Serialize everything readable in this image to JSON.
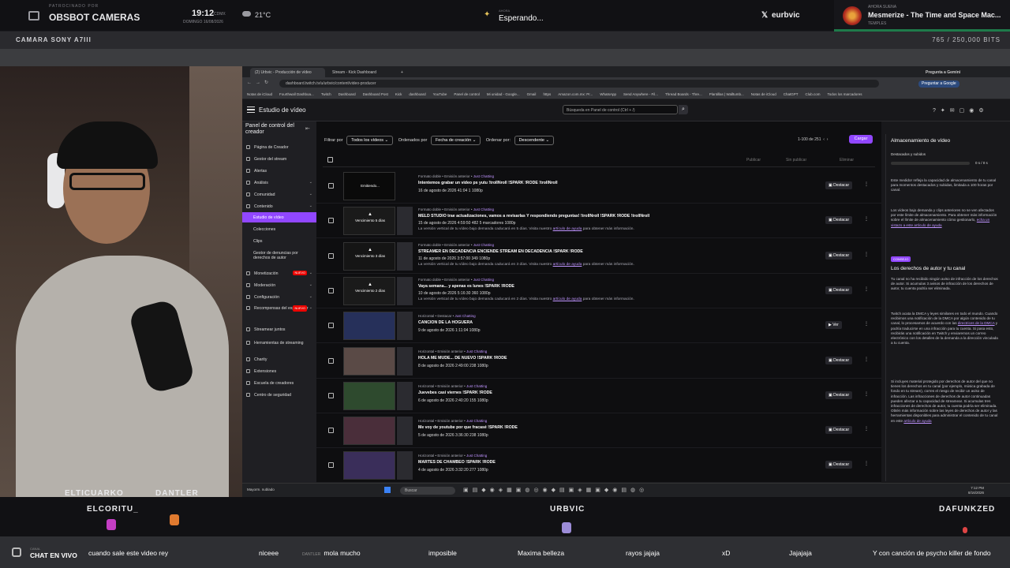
{
  "overlay": {
    "camera_sub": "PATROCINADO POR",
    "camera_name": "OBSBOT CAMERAS",
    "time": "19:12",
    "timezone": "CDMX",
    "date": "DOMINGO 16/08/2026",
    "temperature": "21°C",
    "now_playing_sub": "AHORA",
    "now_playing": "Esperando...",
    "x_handle": "eurbvic",
    "song_sub": "AHORA SUENA",
    "song_title": "Mesmerize - The Time and Space Mac...",
    "song_artist": "TEMPLES",
    "camera_label": "CAMARA SONY A7III",
    "bits": "765 / 250,000 BITS"
  },
  "browser": {
    "tabs": [
      "(2) Urbvic - Producción de vídeo",
      "Stream - Kick Dashboard",
      "+"
    ],
    "address": "dashboard.twitch.tv/u/urbvic/content/video-producer",
    "gemini": "Pregunta a Gemini",
    "google_btn": "Preguntar a Google",
    "bookmarks": [
      "Notas de iCloud",
      "Fourthwall Dashboa...",
      "Twitch",
      "Dashboard",
      "Dashboard Post",
      "Kick",
      "dashboard",
      "YouTube",
      "Panel de control",
      "Mi unidad - Google...",
      "Gmail",
      "https",
      "Amazon.com.mx: Pr...",
      "WhatsApp",
      "Send Anywhere - Fil...",
      "Thread Boards - Thre...",
      "Plantillas | Walltumb...",
      "Notas de iCloud",
      "ChatGPT",
      "Club.com",
      "Todos los marcadores"
    ]
  },
  "twitch": {
    "title": "Estudio de vídeo",
    "search_placeholder": "Búsqueda en Panel de control (Ctrl + /)",
    "sidebar_title": "Panel de control del creador",
    "nav": [
      {
        "label": "Página de Creador"
      },
      {
        "label": "Gestor del stream"
      },
      {
        "label": "Alertas"
      },
      {
        "label": "Análisis"
      },
      {
        "label": "Comunidad"
      },
      {
        "label": "Contenido"
      },
      {
        "label": "Estudio de vídeo"
      },
      {
        "label": "Colecciones"
      },
      {
        "label": "Clips"
      },
      {
        "label": "Gestor de denuncias por derechos de autor"
      },
      {
        "label": "Monetización"
      },
      {
        "label": "Moderación"
      },
      {
        "label": "Configuración"
      },
      {
        "label": "Recompensas del espectador"
      },
      {
        "label": "Streamear juntos"
      },
      {
        "label": "Herramientas de streaming"
      },
      {
        "label": "Charity"
      },
      {
        "label": "Extensiones"
      },
      {
        "label": "Escuela de creadores"
      },
      {
        "label": "Centro de seguridad"
      }
    ],
    "badge_new": "NUEVO",
    "filters": {
      "filter_label": "Filtrar por",
      "filter_value": "Todos los vídeos",
      "sort_label": "Ordenados por",
      "sort_value": "Fecha de creación",
      "order_label": "Ordenar por:",
      "order_value": "Descendente",
      "pager": "1-100 de 251",
      "load": "Cargar"
    },
    "bulk_actions": [
      "Publicar",
      "Sin publicar",
      "Eliminar"
    ],
    "videos": [
      {
        "thumb": "Emitiendo...",
        "meta": "Formato doble • Emisión anterior • ",
        "cat": "Just Chatting",
        "title": "Intentemos grabar un video ps yutu !trollNroll !SPARK !RODE !trollNroll",
        "info": "16 de agosto de 2026  41:04  1  1080p",
        "note": "",
        "link": "",
        "note2": "",
        "action": "Destacar"
      },
      {
        "thumb": "Vencimiento 5 días",
        "meta": "Formato doble • Emisión anterior • ",
        "cat": "Just Chatting",
        "title": "MELD STUDIO trae actualizaciones, vamos a revisarlas  Y respondiendo preguntas! !trollNroll !SPARK !RODE !trollNroll",
        "info": "15 de agosto de 2026  4:59:50  482  5 marcadores  1080p",
        "note": "La versión vertical de tu vídeo bajo demanda caducará en 5 días. Visita nuestro ",
        "link": "artículo de ayuda",
        "note2": " para obtener más información.",
        "action": "Destacar"
      },
      {
        "thumb": "Vencimiento 3 días",
        "meta": "Formato doble • Emisión anterior • ",
        "cat": "Just Chatting",
        "title": "STREAMER EN DECADENCIA ENCIENDE STREAM EN DECADENCIA !SPARK !RODE",
        "info": "11 de agosto de 2026  3:57:00  349  1080p",
        "note": "La versión vertical de tu vídeo bajo demanda caducará en 3 días. Visita nuestro ",
        "link": "artículo de ayuda",
        "note2": " para obtener más información.",
        "action": "Destacar"
      },
      {
        "thumb": "Vencimiento 2 días",
        "meta": "Formato doble • Emisión anterior • ",
        "cat": "Just Chatting",
        "title": "Vaya semana... y apenas es lunes !SPARK !RODE",
        "info": "10 de agosto de 2026  5:16:30  360  1080p",
        "note": "La versión vertical de tu vídeo bajo demanda caducará en 2 días. Visita nuestro ",
        "link": "artículo de ayuda",
        "note2": " para obtener más información.",
        "action": "Destacar"
      },
      {
        "thumb": "",
        "meta": "Horizontal • Destacar • ",
        "cat": "Just Chatting",
        "title": "CANCION DE LA HOGUERA",
        "info": "9 de agosto de 2026  1:11:04  1080p",
        "note": "",
        "link": "",
        "note2": "",
        "action": "Ver"
      },
      {
        "thumb": "",
        "meta": "Horizontal • Emisión anterior • ",
        "cat": "Just Chatting",
        "title": "HOLA ME MUDE... DE NUEVO !SPARK !RODE",
        "info": "8 de agosto de 2026  2:49:00  238  1080p",
        "note": "",
        "link": "",
        "note2": "",
        "action": "Destacar"
      },
      {
        "thumb": "",
        "meta": "Horizontal • Emisión anterior • ",
        "cat": "Just Chatting",
        "title": "Juevebes casi viernes !SPARK !RODE",
        "info": "6 de agosto de 2026  2:40:20  155  1080p",
        "note": "",
        "link": "",
        "note2": "",
        "action": "Destacar"
      },
      {
        "thumb": "",
        "meta": "Horizontal • Emisión anterior • ",
        "cat": "Just Chatting",
        "title": "Me voy de youtube por que fracasé !SPARK !RODE",
        "info": "5 de agosto de 2026  3:36:30  238  1080p",
        "note": "",
        "link": "",
        "note2": "",
        "action": "Destacar"
      },
      {
        "thumb": "",
        "meta": "Horizontal • Emisión anterior • ",
        "cat": "Just Chatting",
        "title": "MARTES DE CHAMBEO !SPARK !RODE",
        "info": "4 de agosto de 2026  3:32:20  277  1080p",
        "note": "",
        "link": "",
        "note2": "",
        "action": "Destacar"
      }
    ],
    "panel": {
      "heading": "Almacenamiento de vídeo",
      "sub": "Destacados y subidos",
      "ratio": "0 s / 0 s",
      "p1": "Este medidor refleja la capacidad de almacenamiento de tu canal para momentos destacados y subidas, limitada a 100 horas por canal.",
      "p2": "Los vídeos bajo demanda y clips anteriores no se ven afectados por este límite de almacenamiento. Para obtener más información sobre el límite de almacenamiento cómo gestionarlo, ",
      "p2_link": "echa un vistazo a este artículo de ayuda",
      "tag": "CONSEJO",
      "heading2": "Los derechos de autor y tu canal",
      "p3": "Tu canal no ha recibido ningún aviso de infracción de los derechos de autor. Si acumulas 3 avisos de infracción de los derechos de autor, tu cuenta podría ser eliminada.",
      "p4": "Twitch acata la DMCA y leyes similares en todo el mundo. Cuando recibimos una notificación de la DMCA por algún contenido de tu canal, lo procesamos de acuerdo con las ",
      "p4_link": "directrices de la DMCA",
      "p4b": " y podría traducirse en una infracción para tu cuenta. Si pasa esto, recibirás una notificación en Twitch y enviaremos un correo electrónico con los detalles de la demanda a la dirección vinculada a tu cuenta.",
      "p5": "Si incluyes material protegido por derechos de autor del que no tienes los derechos en tu canal (por ejemplo, música grabada de fondo en tu stream), corres el riesgo de recibir un aviso de infracción. Las infracciones de derechos de autor continuadas pueden afectar a tu capacidad de streamear. Si acumulas tres infracciones de derechos de autor, tu cuenta podría ser eliminada. Obtén más información sobre las leyes de derechos de autor y las herramientas disponibles para administrar el contenido de tu canal en este ",
      "p5_link": "artículo de ayuda"
    }
  },
  "taskbar": {
    "weather": "Mayorm. nublado",
    "search": "Buscar",
    "clock_time": "7:12 PM",
    "clock_date": "8/16/2026"
  },
  "bottom": {
    "users": [
      "ELTICUARKO",
      "DANTLER",
      "ELCORITU_",
      "URBVIC",
      "DAFUNKZED"
    ],
    "chat_sub": "CANAL",
    "chat_label": "CHAT EN VIVO",
    "messages": [
      {
        "who": "",
        "text": "cuando sale este video rey"
      },
      {
        "who": "",
        "text": "niceee"
      },
      {
        "who": "DANTLER",
        "text": "mola mucho"
      },
      {
        "who": "",
        "text": "imposible"
      },
      {
        "who": "",
        "text": "Maxima belleza"
      },
      {
        "who": "",
        "text": "rayos jajaja"
      },
      {
        "who": "",
        "text": "xD"
      },
      {
        "who": "",
        "text": "Jajajaja"
      },
      {
        "who": "",
        "text": "Y con canción de psycho killer de fondo"
      }
    ]
  }
}
